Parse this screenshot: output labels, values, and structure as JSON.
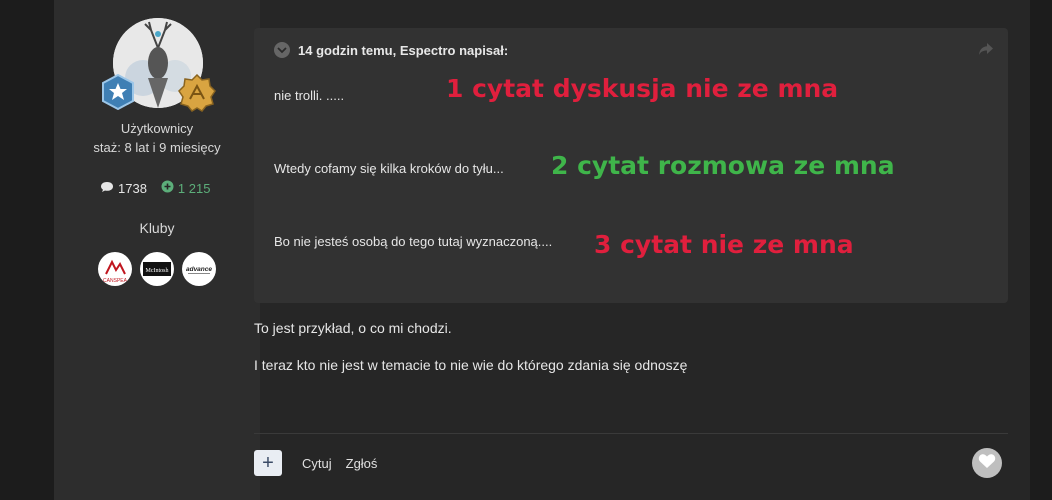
{
  "author": {
    "group": "Użytkownicy",
    "tenure": "staż: 8 lat i 9 miesięcy",
    "posts_count": "1738",
    "reputation": "1 215",
    "clubs_label": "Kluby",
    "clubs": [
      "CANSPEA",
      "McIntosh",
      "advance"
    ]
  },
  "quote": {
    "header": "14 godzin temu, Espectro napisał:",
    "lines": [
      "nie trolli. .....",
      "Wtedy cofamy się kilka kroków do tyłu...",
      "Bo nie jesteś osobą do tego tutaj wyznaczoną...."
    ],
    "annotations": [
      "1 cytat dyskusja nie ze mna",
      "2 cytat rozmowa ze mna",
      "3 cytat nie ze mna"
    ]
  },
  "body": {
    "lines": [
      "To jest przykład, o co mi chodzi.",
      "I teraz kto nie jest w temacie to nie wie do którego zdania się odnoszę"
    ]
  },
  "actions": {
    "plus_label": "+",
    "quote_label": "Cytuj",
    "report_label": "Zgłoś"
  },
  "colors": {
    "annotation_red": "#e01f3d",
    "annotation_green": "#3fb54a",
    "reputation_green": "#5cae7a"
  }
}
